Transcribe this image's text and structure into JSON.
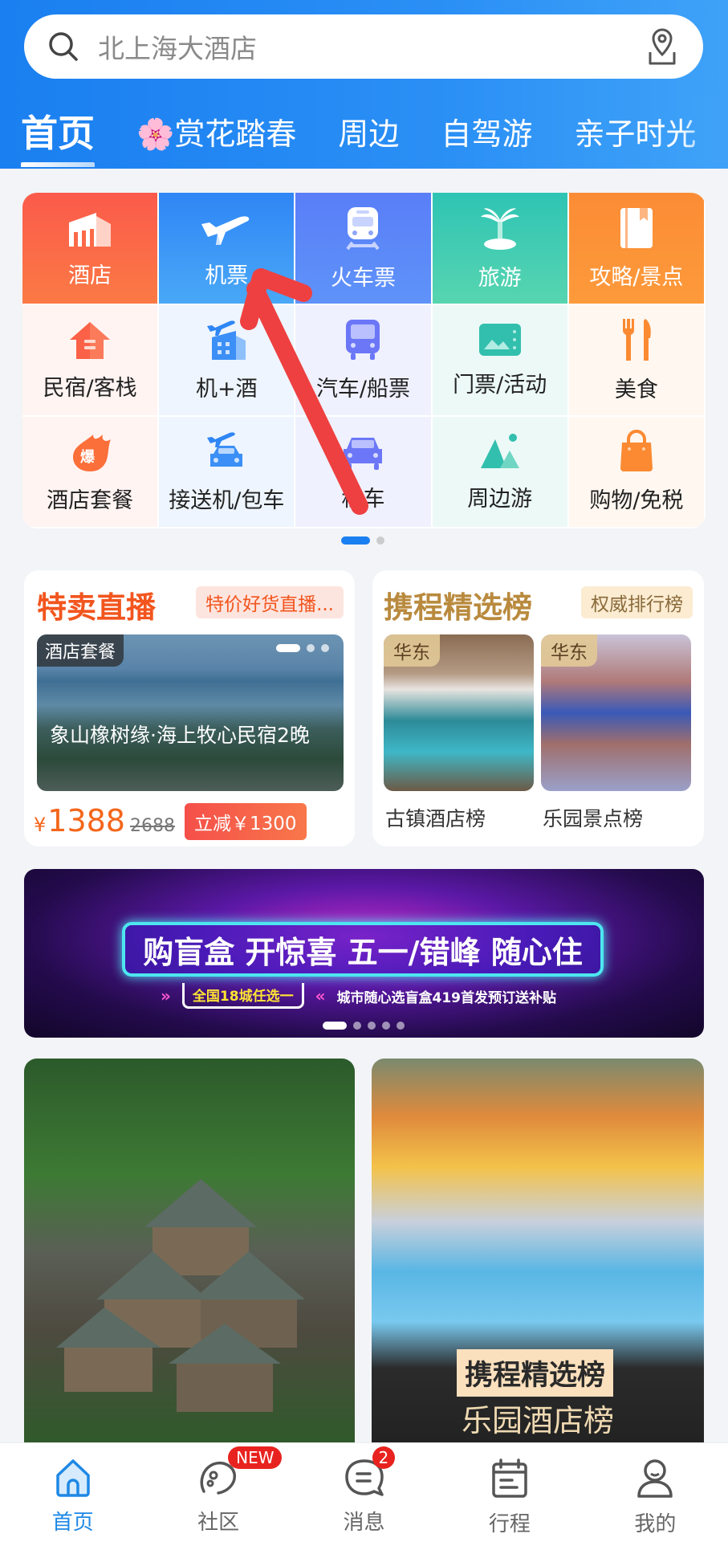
{
  "search": {
    "placeholder": "北上海大酒店",
    "search_icon": "search-icon",
    "map_icon": "map-pin-icon"
  },
  "tabs": [
    {
      "label": "首页",
      "active": true
    },
    {
      "label": "赏花踏春",
      "icon": "🌸"
    },
    {
      "label": "周边"
    },
    {
      "label": "自驾游"
    },
    {
      "label": "亲子时光"
    }
  ],
  "grid": {
    "top": [
      {
        "label": "酒店",
        "icon": "hotel-icon"
      },
      {
        "label": "机票",
        "icon": "plane-icon"
      },
      {
        "label": "火车票",
        "icon": "train-icon"
      },
      {
        "label": "旅游",
        "icon": "palm-tree-icon"
      },
      {
        "label": "攻略/景点",
        "icon": "guidebook-icon"
      }
    ],
    "row2": [
      {
        "label": "民宿/客栈",
        "icon": "house-icon"
      },
      {
        "label": "机+酒",
        "icon": "plane-hotel-icon"
      },
      {
        "label": "汽车/船票",
        "icon": "bus-icon"
      },
      {
        "label": "门票/活动",
        "icon": "ticket-icon"
      },
      {
        "label": "美食",
        "icon": "fork-knife-icon"
      }
    ],
    "row3": [
      {
        "label": "酒店套餐",
        "icon": "hot-deal-icon",
        "badge": "爆"
      },
      {
        "label": "接送机/包车",
        "icon": "airport-car-icon"
      },
      {
        "label": "租车",
        "icon": "car-icon"
      },
      {
        "label": "周边游",
        "icon": "mountain-icon"
      },
      {
        "label": "购物/免税",
        "icon": "shopping-bag-icon"
      }
    ],
    "page_dots": 2
  },
  "flash_sale": {
    "title": "特卖直播",
    "tag": "特价好货直播...",
    "photo_badge": "酒店套餐",
    "photo_title": "象山橡树缘·海上牧心民宿2晚",
    "currency": "¥",
    "price": "1388",
    "old_price": "2688",
    "discount": "立减￥1300"
  },
  "ranking": {
    "title": "携程精选榜",
    "tag": "权威排行榜",
    "items": [
      {
        "badge": "华东",
        "caption": "古镇酒店榜"
      },
      {
        "badge": "华东",
        "caption": "乐园景点榜"
      }
    ]
  },
  "banner": {
    "headline": "购盲盒 开惊喜 五一/错峰 随心住",
    "highlight": "全国18城任选一",
    "subline": "城市随心选盲盒419首发预订送补贴",
    "dots": 5
  },
  "feed": {
    "right_tag": "携程精选榜",
    "right_caption": "乐园酒店榜"
  },
  "bottom_nav": [
    {
      "label": "首页",
      "icon": "home-icon",
      "active": true
    },
    {
      "label": "社区",
      "icon": "community-icon",
      "badge": "NEW"
    },
    {
      "label": "消息",
      "icon": "message-icon",
      "badge": "2"
    },
    {
      "label": "行程",
      "icon": "calendar-icon"
    },
    {
      "label": "我的",
      "icon": "user-icon"
    }
  ],
  "colors": {
    "brand": "#1a7ff0",
    "price": "#f4661b",
    "badge_red": "#e8231f",
    "annotation_arrow": "#ee4040"
  }
}
